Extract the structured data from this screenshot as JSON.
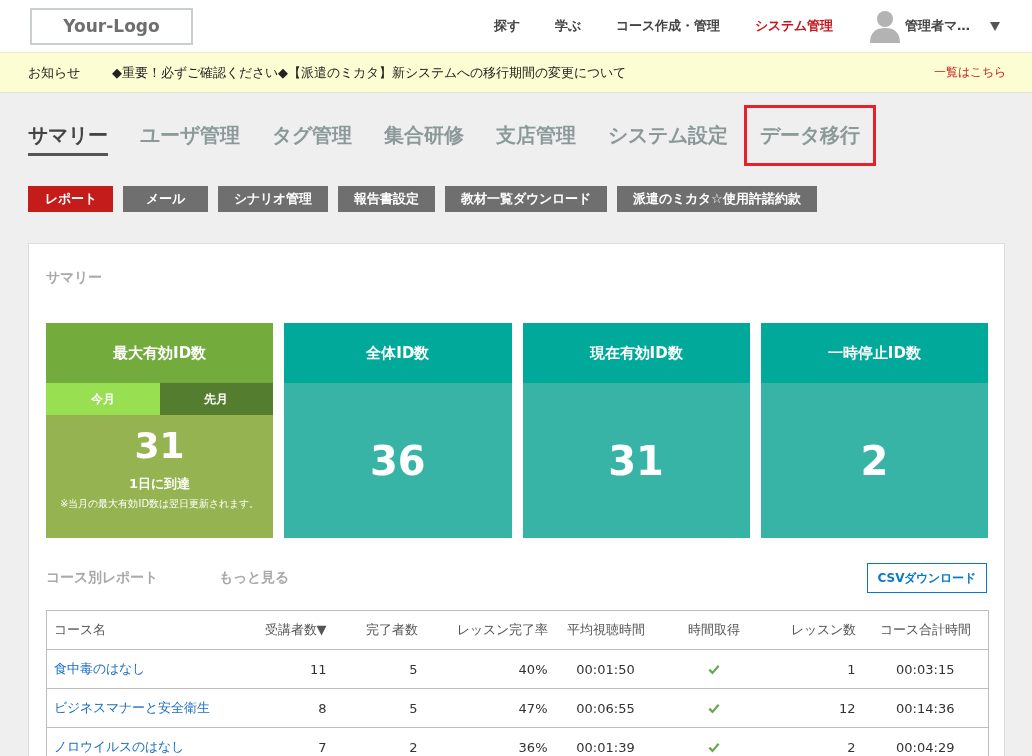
{
  "header": {
    "logo": "Your-Logo",
    "nav": [
      {
        "label": "探す",
        "selected": false
      },
      {
        "label": "学ぶ",
        "selected": false
      },
      {
        "label": "コース作成・管理",
        "selected": false
      },
      {
        "label": "システム管理",
        "selected": true
      }
    ],
    "user": {
      "name": "管理者マ…"
    }
  },
  "notice": {
    "label": "お知らせ",
    "message": "◆重要！必ずご確認ください◆【派遣のミカタ】新システムへの移行期間の変更について",
    "link": "一覧はこちら"
  },
  "tabs": [
    {
      "label": "サマリー",
      "selected": true,
      "highlighted": false
    },
    {
      "label": "ユーザ管理",
      "selected": false,
      "highlighted": false
    },
    {
      "label": "タグ管理",
      "selected": false,
      "highlighted": false
    },
    {
      "label": "集合研修",
      "selected": false,
      "highlighted": false
    },
    {
      "label": "支店管理",
      "selected": false,
      "highlighted": false
    },
    {
      "label": "システム設定",
      "selected": false,
      "highlighted": false
    },
    {
      "label": "データ移行",
      "selected": false,
      "highlighted": true
    }
  ],
  "sub_tabs": [
    {
      "label": "レポート",
      "selected": true
    },
    {
      "label": "メール",
      "selected": false
    },
    {
      "label": "シナリオ管理",
      "selected": false
    },
    {
      "label": "報告書設定",
      "selected": false
    },
    {
      "label": "教材一覧ダウンロード",
      "selected": false
    },
    {
      "label": "派遣のミカタ☆使用許諾約款",
      "selected": false
    }
  ],
  "summary": {
    "title": "サマリー",
    "cards": [
      {
        "kind": "monthly",
        "title": "最大有効ID数",
        "periods": [
          {
            "label": "今月",
            "selected": true
          },
          {
            "label": "先月",
            "selected": false
          }
        ],
        "value": "31",
        "detail": "1日に到達",
        "note": "※当月の最大有効ID数は翌日更新されます。"
      },
      {
        "kind": "simple",
        "title": "全体ID数",
        "value": "36"
      },
      {
        "kind": "simple",
        "title": "現在有効ID数",
        "value": "31"
      },
      {
        "kind": "simple",
        "title": "一時停止ID数",
        "value": "2"
      }
    ]
  },
  "course_report": {
    "title": "コース別レポート",
    "more_link": "もっと見る",
    "csv_button": "CSVダウンロード",
    "table": {
      "columns": [
        "コース名",
        "受講者数▼",
        "完了者数",
        "レッスン完了率",
        "平均視聴時間",
        "時間取得",
        "レッスン数",
        "コース合計時間"
      ],
      "rows": [
        {
          "course": "食中毒のはなし",
          "enrolled": "11",
          "completed": "5",
          "completion_rate": "40%",
          "avg_view_time": "00:01:50",
          "time_acquired": true,
          "lessons": "1",
          "total_time": "00:03:15"
        },
        {
          "course": "ビジネスマナーと安全衛生",
          "enrolled": "8",
          "completed": "5",
          "completion_rate": "47%",
          "avg_view_time": "00:06:55",
          "time_acquired": true,
          "lessons": "12",
          "total_time": "00:14:36"
        },
        {
          "course": "ノロウイルスのはなし",
          "enrolled": "7",
          "completed": "2",
          "completion_rate": "36%",
          "avg_view_time": "00:01:39",
          "time_acquired": true,
          "lessons": "2",
          "total_time": "00:04:29"
        }
      ]
    }
  }
}
